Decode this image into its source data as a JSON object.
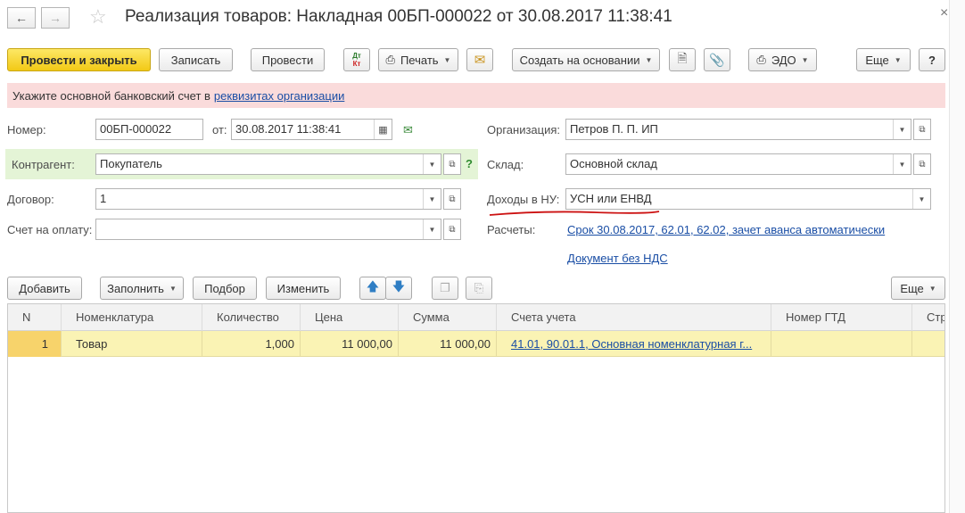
{
  "window": {
    "title": "Реализация товаров: Накладная 00БП-000022 от 30.08.2017 11:38:41",
    "close": "×",
    "back_icon": "arrow-left-icon",
    "forward_icon": "arrow-right-icon",
    "favorite_icon": "star-icon"
  },
  "toolbar": {
    "post_close": "Провести и закрыть",
    "save": "Записать",
    "post": "Провести",
    "dtkt_top": "Дт",
    "dtkt_bottom": "Кт",
    "print": "Печать",
    "create_based": "Создать на основании",
    "edo": "ЭДО",
    "more": "Еще",
    "help": "?"
  },
  "banner": {
    "text": "Укажите основной банковский счет в",
    "link": "реквизитах организации"
  },
  "form": {
    "number_label": "Номер:",
    "number_value": "00БП-000022",
    "date_label": "от:",
    "date_value": "30.08.2017 11:38:41",
    "org_label": "Организация:",
    "org_value": "Петров П. П. ИП",
    "counterparty_label": "Контрагент:",
    "counterparty_value": "Покупатель",
    "help_mark": "?",
    "warehouse_label": "Склад:",
    "warehouse_value": "Основной склад",
    "contract_label": "Договор:",
    "contract_value": "1",
    "income_label": "Доходы в НУ:",
    "income_value": "УСН или ЕНВД",
    "invoice_label": "Счет на оплату:",
    "invoice_value": "",
    "settlements_label": "Расчеты:",
    "settlements_link": "Срок 30.08.2017, 62.01, 62.02, зачет аванса автоматически",
    "vat_link": "Документ без НДС"
  },
  "table_toolbar": {
    "add": "Добавить",
    "fill": "Заполнить",
    "select": "Подбор",
    "change": "Изменить",
    "more": "Еще"
  },
  "table": {
    "headers": [
      "N",
      "Номенклатура",
      "Количество",
      "Цена",
      "Сумма",
      "Счета учета",
      "Номер ГТД",
      "Стр"
    ],
    "rows": [
      {
        "n": "1",
        "item": "Товар",
        "qty": "1,000",
        "price": "11 000,00",
        "sum": "11 000,00",
        "accounts": "41.01, 90.01.1, Основная номенклатурная г...",
        "gtd": ""
      }
    ]
  },
  "colors": {
    "primary_button": "#f2c916",
    "banner_bg": "#fadbdb",
    "counterparty_bg": "#e4f4d6",
    "selected_row": "#faf3b4",
    "link": "#1a4ea5",
    "annotation": "#cc1111"
  }
}
